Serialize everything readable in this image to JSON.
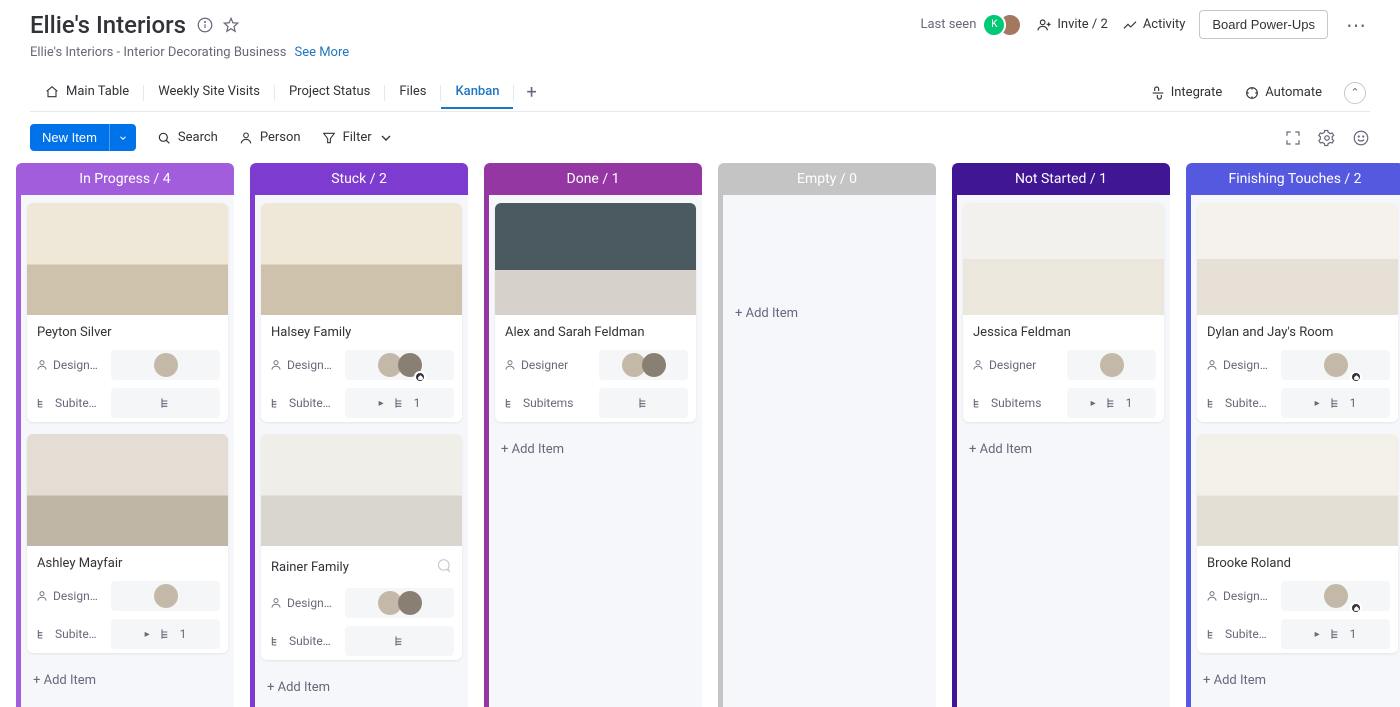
{
  "header": {
    "title": "Ellie's Interiors",
    "subtitle": "Ellie's Interiors - Interior Decorating Business",
    "see_more": "See More",
    "last_seen": "Last seen",
    "invite": "Invite / 2",
    "activity": "Activity",
    "powerups": "Board Power-Ups"
  },
  "tabs": {
    "main": "Main Table",
    "weekly": "Weekly Site Visits",
    "project": "Project Status",
    "files": "Files",
    "kanban": "Kanban",
    "integrate": "Integrate",
    "automate": "Automate"
  },
  "toolbar": {
    "new_item": "New Item",
    "search": "Search",
    "person": "Person",
    "filter": "Filter"
  },
  "labels": {
    "designer": "Designer",
    "designer_trunc": "Design…",
    "subitems": "Subitems",
    "subitems_trunc": "Subite…",
    "add_item": "+ Add Item"
  },
  "columns": [
    {
      "title": "In Progress / 4",
      "color": "#a25ddc",
      "cards": [
        {
          "name": "Peyton Silver",
          "thumb": "thumb-kitchen",
          "labelMode": "trunc",
          "avatars": 1,
          "avatarBadge": false,
          "subLabel": "trunc",
          "subCount": null
        },
        {
          "name": "Ashley Mayfair",
          "thumb": "thumb-room",
          "labelMode": "trunc",
          "avatars": 1,
          "avatarBadge": false,
          "subLabel": "trunc",
          "subCount": 1,
          "caret": true
        }
      ],
      "showAdd": true
    },
    {
      "title": "Stuck / 2",
      "color": "#7e3bd0",
      "cards": [
        {
          "name": "Halsey Family",
          "thumb": "thumb-kitchen",
          "labelMode": "trunc",
          "avatars": 2,
          "avatarBadge": true,
          "subLabel": "trunc",
          "subCount": 1,
          "caret": true
        },
        {
          "name": "Rainer Family",
          "thumb": "thumb-living",
          "labelMode": "trunc",
          "avatars": 2,
          "avatarBadge": false,
          "subLabel": "trunc",
          "subCount": null,
          "chat": true
        }
      ],
      "showAdd": true
    },
    {
      "title": "Done / 1",
      "color": "#9437a3",
      "cards": [
        {
          "name": "Alex and Sarah Feldman",
          "thumb": "thumb-bath",
          "labelMode": "full",
          "avatars": 2,
          "avatarBadge": false,
          "subLabel": "full",
          "subCount": null
        }
      ],
      "showAdd": true
    },
    {
      "title": "Empty / 0",
      "color": "#c4c4c4",
      "cards": [],
      "showAdd": true,
      "emptyPad": true
    },
    {
      "title": "Not Started / 1",
      "color": "#401694",
      "cards": [
        {
          "name": "Jessica Feldman",
          "thumb": "thumb-bed",
          "labelMode": "full",
          "avatars": 1,
          "avatarBadge": false,
          "subLabel": "full",
          "subCount": 1,
          "caret": true
        }
      ],
      "showAdd": true
    },
    {
      "title": "Finishing Touches / 2",
      "color": "#5559df",
      "cards": [
        {
          "name": "Dylan and Jay's Room",
          "thumb": "thumb-bunk",
          "labelMode": "trunc",
          "avatars": 1,
          "avatarBadge": true,
          "subLabel": "trunc",
          "subCount": 1,
          "caret": true
        },
        {
          "name": "Brooke Roland",
          "thumb": "thumb-kitchen2",
          "labelMode": "trunc",
          "avatars": 1,
          "avatarBadge": true,
          "subLabel": "trunc",
          "subCount": 1,
          "caret": true
        }
      ],
      "showAdd": true
    }
  ]
}
